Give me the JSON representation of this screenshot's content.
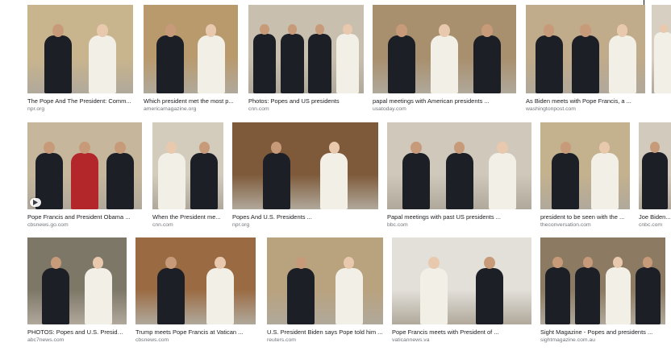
{
  "results": [
    {
      "caption": "The Pope And The President: Comm...",
      "source": "npr.org",
      "figures": [
        "dark",
        "white"
      ],
      "bg": "#c9b58d"
    },
    {
      "caption": "Which president met the most p...",
      "source": "americamagazine.org",
      "figures": [
        "dark",
        "white"
      ],
      "bg": "#b99a6d"
    },
    {
      "caption": "Photos: Popes and US presidents",
      "source": "cnn.com",
      "figures": [
        "dark",
        "dark",
        "dark",
        "white"
      ],
      "bg": "#c8bfae"
    },
    {
      "caption": "papal meetings with American presidents ...",
      "source": "usatoday.com",
      "figures": [
        "dark",
        "white",
        "dark"
      ],
      "bg": "#a88f6d"
    },
    {
      "caption": "As Biden meets with Pope Francis, a ...",
      "source": "washingtonpost.com",
      "figures": [
        "dark",
        "dark",
        "white"
      ],
      "bg": "#c0ab8a"
    },
    {
      "caption": "",
      "source": "",
      "figures": [
        "white"
      ],
      "bg": "#d6cfc2"
    },
    {
      "caption": "Pope Francis and President Obama ...",
      "source": "cbsnews.go.com",
      "figures": [
        "dark",
        "red",
        "dark"
      ],
      "bg": "#c6b79c",
      "video": true
    },
    {
      "caption": "When the President me...",
      "source": "cnn.com",
      "figures": [
        "white",
        "dark"
      ],
      "bg": "#d3ccbd"
    },
    {
      "caption": "Popes And U.S. Presidents ...",
      "source": "npr.org",
      "figures": [
        "dark",
        "white"
      ],
      "bg": "#7e5a3a"
    },
    {
      "caption": "Papal meetings with past US presidents ...",
      "source": "bbc.com",
      "figures": [
        "dark",
        "dark",
        "white"
      ],
      "bg": "#cfc8bb"
    },
    {
      "caption": "president to be seen with the ...",
      "source": "theconversation.com",
      "figures": [
        "dark",
        "white"
      ],
      "bg": "#c4b18e"
    },
    {
      "caption": "Joe Biden...",
      "source": "cnbc.com",
      "figures": [
        "dark"
      ],
      "bg": "#d2cabd"
    },
    {
      "caption": "PHOTOS: Popes and U.S. Presiden...",
      "source": "abc7news.com",
      "figures": [
        "dark",
        "white"
      ],
      "bg": "#7d7768"
    },
    {
      "caption": "Trump meets Pope Francis at Vatican ...",
      "source": "cbsnews.com",
      "figures": [
        "dark",
        "white"
      ],
      "bg": "#9a6b43"
    },
    {
      "caption": "U.S. President Biden says Pope told him ...",
      "source": "reuters.com",
      "figures": [
        "dark",
        "white"
      ],
      "bg": "#b9a27e"
    },
    {
      "caption": "Pope Francis meets with President of ...",
      "source": "vaticannews.va",
      "figures": [
        "white",
        "dark"
      ],
      "bg": "#e3e0da"
    },
    {
      "caption": "Sight Magazine - Popes and presidents ...",
      "source": "sightmagazine.com.au",
      "figures": [
        "dark",
        "dark",
        "white",
        "dark"
      ],
      "bg": "#8c7b62"
    }
  ]
}
